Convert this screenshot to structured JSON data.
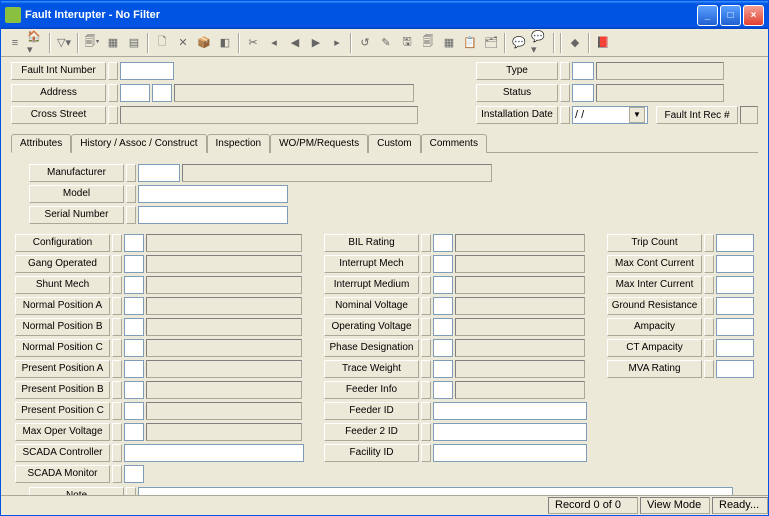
{
  "window": {
    "title": "Fault Interupter - No Filter"
  },
  "win_btns": {
    "min": "_",
    "max": "□",
    "close": "×"
  },
  "toolbar_icons": [
    "≡",
    "🏠▾",
    "—",
    "▽▾",
    "—",
    "🗐▾",
    "▦",
    "▤",
    "—",
    "🗋",
    "✕",
    "📦",
    "◧",
    "—",
    "✂",
    "◂",
    "◀",
    "▶",
    "▸",
    "—",
    "↺",
    "✎",
    "🖫",
    "🗐",
    "▦",
    "📋",
    "🗂",
    "—",
    "💬",
    "💬▾",
    "—",
    "—",
    "◆",
    "—",
    "📕"
  ],
  "header": {
    "left_labels": [
      "Fault Int Number",
      "Address",
      "Cross Street"
    ],
    "right_labels": [
      "Type",
      "Status",
      "Installation Date"
    ],
    "install_date_value": "/  /",
    "rec_btn": "Fault Int Rec #"
  },
  "tabs": [
    "Attributes",
    "History / Assoc / Construct",
    "Inspection",
    "WO/PM/Requests",
    "Custom",
    "Comments"
  ],
  "attrs_top": [
    "Manufacturer",
    "Model",
    "Serial Number"
  ],
  "col1": [
    "Configuration",
    "Gang Operated",
    "Shunt Mech",
    "Normal Position A",
    "Normal Position B",
    "Normal Position C",
    "Present Position A",
    "Present Position B",
    "Present Position C",
    "Max Oper Voltage",
    "SCADA Controller",
    "SCADA Monitor"
  ],
  "col2": [
    "BIL Rating",
    "Interrupt Mech",
    "Interrupt Medium",
    "Nominal Voltage",
    "Operating Voltage",
    "Phase Designation",
    "Trace Weight",
    "Feeder Info"
  ],
  "col2b": [
    "Feeder ID",
    "Feeder 2 ID",
    "Facility ID"
  ],
  "col3": [
    "Trip Count",
    "Max Cont Current",
    "Max Inter Current",
    "Ground Resistance",
    "Ampacity",
    "CT Ampacity",
    "MVA Rating"
  ],
  "note_label": "Note",
  "status": {
    "record": "Record 0 of 0",
    "mode": "View Mode",
    "ready": "Ready..."
  }
}
